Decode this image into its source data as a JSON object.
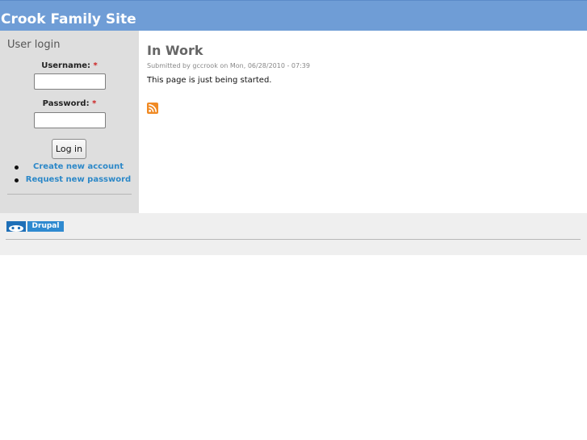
{
  "header": {
    "site_name": "Crook Family Site"
  },
  "sidebar": {
    "block_title": "User login",
    "username_label": "Username:",
    "password_label": "Password:",
    "required_marker": "*",
    "username_value": "",
    "password_value": "",
    "login_button": "Log in",
    "links": [
      {
        "label": "Create new account"
      },
      {
        "label": "Request new password"
      }
    ]
  },
  "node": {
    "title": "In Work",
    "submitted": "Submitted by gccrook on Mon, 06/28/2010 - 07:39",
    "body": "This page is just being started.",
    "feed_icon": "rss-feed-icon"
  },
  "footer": {
    "badge_text": "Drupal",
    "badge_icon": "drupal-drop-icon"
  },
  "colors": {
    "header_bg": "#6f9dd6",
    "sidebar_bg": "#dedede",
    "link": "#2c88c8",
    "rss": "#f08a24",
    "footer_bg": "#efefef"
  }
}
